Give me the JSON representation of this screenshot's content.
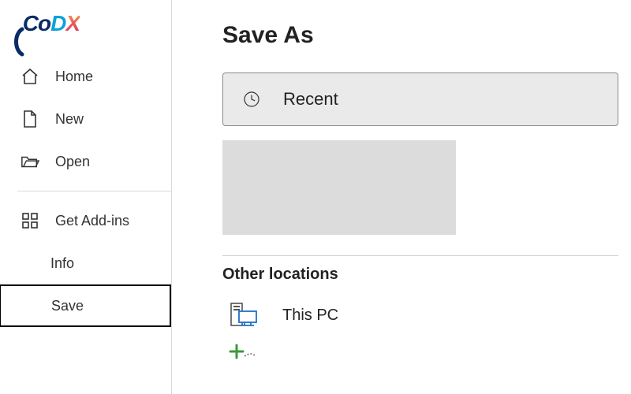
{
  "sidebar": {
    "items": [
      {
        "label": "Home"
      },
      {
        "label": "New"
      },
      {
        "label": "Open"
      },
      {
        "label": "Get Add-ins"
      },
      {
        "label": "Info"
      },
      {
        "label": "Save"
      }
    ]
  },
  "main": {
    "title": "Save As",
    "recent_label": "Recent",
    "other_locations_heading": "Other locations",
    "this_pc_label": "This PC"
  }
}
